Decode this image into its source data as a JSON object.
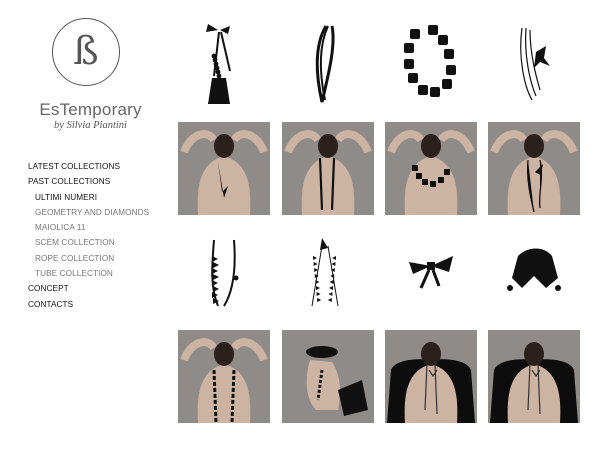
{
  "brand": {
    "name": "EsTemporary",
    "byline": "by Silvia Piantini",
    "logo_glyph": "ß",
    "logo_icon": "beta-monogram-icon"
  },
  "nav": {
    "items": [
      {
        "label": "LATEST COLLECTIONS",
        "level": "top"
      },
      {
        "label": "PAST COLLECTIONS",
        "level": "top"
      },
      {
        "label": "ULTIMI NUMERI",
        "level": "sub",
        "active": true
      },
      {
        "label": "GEOMETRY AND DIAMONDS",
        "level": "sub"
      },
      {
        "label": "MAIOLICA 11",
        "level": "sub"
      },
      {
        "label": "SCÈM COLLECTION",
        "level": "sub"
      },
      {
        "label": "ROPE COLLECTION",
        "level": "sub"
      },
      {
        "label": "TUBE COLLECTION",
        "level": "sub"
      },
      {
        "label": "CONCEPT",
        "level": "top"
      },
      {
        "label": "CONTACTS",
        "level": "top"
      }
    ]
  },
  "gallery": {
    "rows": [
      {
        "kind": "product",
        "items": [
          "bow-tassel-necklace",
          "double-strand-necklace",
          "chunky-bead-necklace",
          "multi-strand-bow-necklace"
        ]
      },
      {
        "kind": "photo",
        "items": [
          "model-back-tassel",
          "model-back-strand",
          "model-front-beads",
          "model-back-multistrand"
        ]
      },
      {
        "kind": "product",
        "items": [
          "bead-strand-necklace",
          "triangle-bead-necklace",
          "ribbon-bow-necklace",
          "knot-ribbon-necklace"
        ]
      },
      {
        "kind": "photo",
        "items": [
          "model-back-beads",
          "model-seated-hat",
          "model-coat-back",
          "model-coat-back-2"
        ]
      }
    ]
  },
  "colors": {
    "photo_bg": "#8f8b88",
    "skin": "#cdb3a1",
    "jewelry": "#111111",
    "nav_active": "#111111",
    "nav_sub": "#777777",
    "brand_text": "#666666"
  }
}
